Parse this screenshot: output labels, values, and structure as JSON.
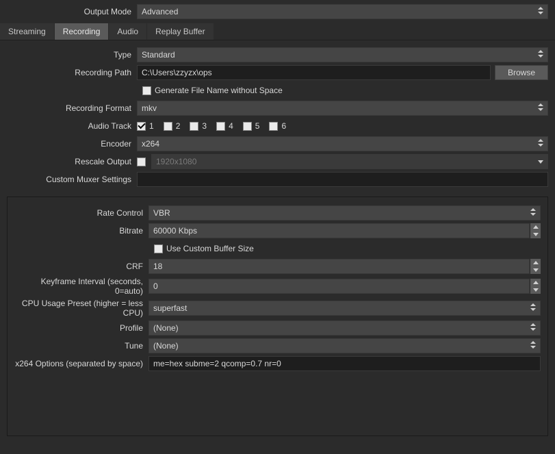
{
  "top": {
    "outputModeLabel": "Output Mode",
    "outputModeValue": "Advanced"
  },
  "tabs": {
    "streaming": "Streaming",
    "recording": "Recording",
    "audio": "Audio",
    "replayBuffer": "Replay Buffer"
  },
  "recording": {
    "typeLabel": "Type",
    "typeValue": "Standard",
    "pathLabel": "Recording Path",
    "pathValue": "C:\\Users\\zzyzx\\ops",
    "browse": "Browse",
    "genFilenameLabel": "Generate File Name without Space",
    "formatLabel": "Recording Format",
    "formatValue": "mkv",
    "audioTrackLabel": "Audio Track",
    "tracks": [
      "1",
      "2",
      "3",
      "4",
      "5",
      "6"
    ],
    "encoderLabel": "Encoder",
    "encoderValue": "x264",
    "rescaleLabel": "Rescale Output",
    "rescaleValue": "1920x1080",
    "muxerLabel": "Custom Muxer Settings",
    "muxerValue": ""
  },
  "x264": {
    "rateControlLabel": "Rate Control",
    "rateControlValue": "VBR",
    "bitrateLabel": "Bitrate",
    "bitrateValue": "60000 Kbps",
    "customBufferLabel": "Use Custom Buffer Size",
    "crfLabel": "CRF",
    "crfValue": "18",
    "keyframeLabel": "Keyframe Interval (seconds, 0=auto)",
    "keyframeValue": "0",
    "cpuPresetLabel": "CPU Usage Preset (higher = less CPU)",
    "cpuPresetValue": "superfast",
    "profileLabel": "Profile",
    "profileValue": "(None)",
    "tuneLabel": "Tune",
    "tuneValue": "(None)",
    "x264OptionsLabel": "x264 Options (separated by space)",
    "x264OptionsValue": "me=hex subme=2 qcomp=0.7 nr=0"
  }
}
